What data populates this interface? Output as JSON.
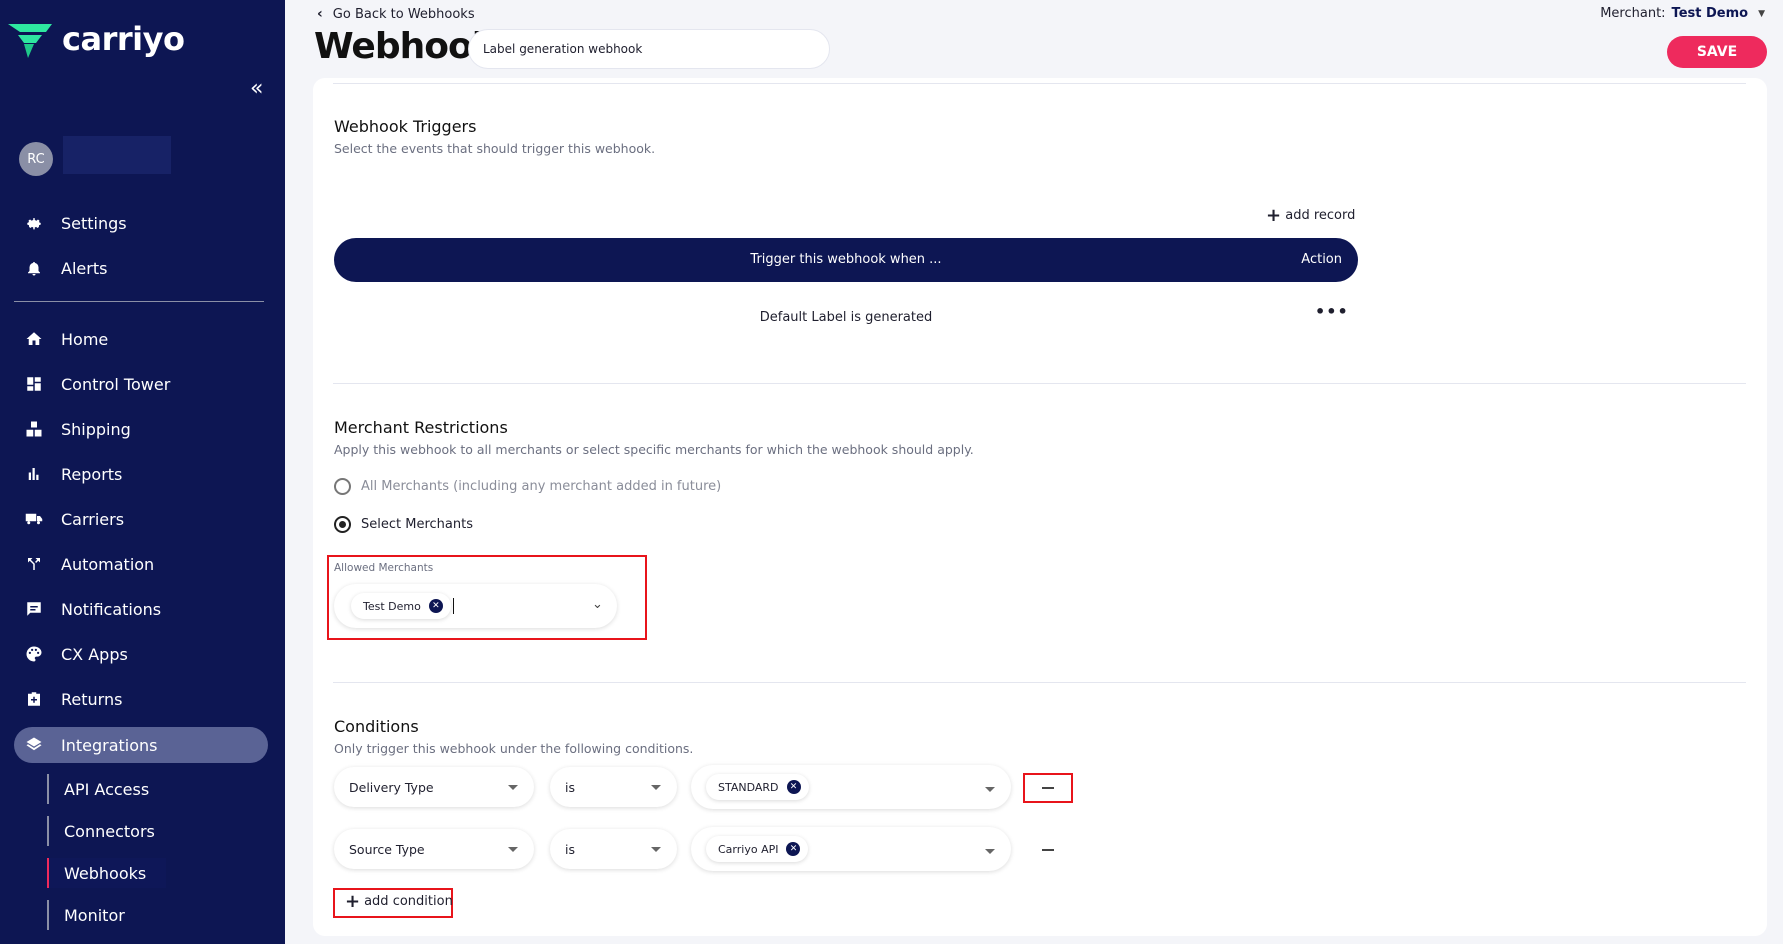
{
  "brand": {
    "name": "carriyo",
    "accent": "#ee2a5d",
    "nav_bg": "#0d1653"
  },
  "sidebar": {
    "collapse_icon": "double-chevron-left-icon",
    "user_initials": "RC",
    "top_items": [
      {
        "label": "Settings",
        "icon": "gear-icon"
      },
      {
        "label": "Alerts",
        "icon": "bell-icon"
      }
    ],
    "items": [
      {
        "label": "Home",
        "icon": "home-icon"
      },
      {
        "label": "Control Tower",
        "icon": "dashboard-icon"
      },
      {
        "label": "Shipping",
        "icon": "boxes-icon"
      },
      {
        "label": "Reports",
        "icon": "bar-chart-icon"
      },
      {
        "label": "Carriers",
        "icon": "truck-icon"
      },
      {
        "label": "Automation",
        "icon": "fork-icon"
      },
      {
        "label": "Notifications",
        "icon": "message-icon"
      },
      {
        "label": "CX Apps",
        "icon": "palette-icon"
      },
      {
        "label": "Returns",
        "icon": "return-box-icon"
      },
      {
        "label": "Integrations",
        "icon": "layers-icon"
      }
    ],
    "sub_items": [
      "API Access",
      "Connectors",
      "Webhooks",
      "Monitor"
    ]
  },
  "header": {
    "back_label": "Go Back to Webhooks",
    "title": "Webhook",
    "name_value": "Label generation webhook",
    "merchant_label": "Merchant:",
    "merchant_value": "Test Demo",
    "save_label": "SAVE"
  },
  "triggers": {
    "title": "Webhook Triggers",
    "description": "Select the events that should trigger this webhook.",
    "add_record_label": "add record",
    "col_trigger": "Trigger this webhook when ...",
    "col_action": "Action",
    "rows": [
      {
        "trigger": "Default Label is generated",
        "action": "•••"
      }
    ]
  },
  "merchants": {
    "title": "Merchant Restrictions",
    "description": "Apply this webhook to all merchants or select specific merchants for which the webhook should apply.",
    "option_all": "All Merchants (including any merchant added in future)",
    "option_select": "Select Merchants",
    "selected_option": "select",
    "allowed_label": "Allowed Merchants",
    "allowed_values": [
      "Test Demo"
    ]
  },
  "conditions": {
    "title": "Conditions",
    "description": "Only trigger this webhook under the following conditions.",
    "rows": [
      {
        "field": "Delivery Type",
        "operator": "is",
        "value": "STANDARD"
      },
      {
        "field": "Source Type",
        "operator": "is",
        "value": "Carriyo API"
      }
    ],
    "add_label": "add condition"
  }
}
